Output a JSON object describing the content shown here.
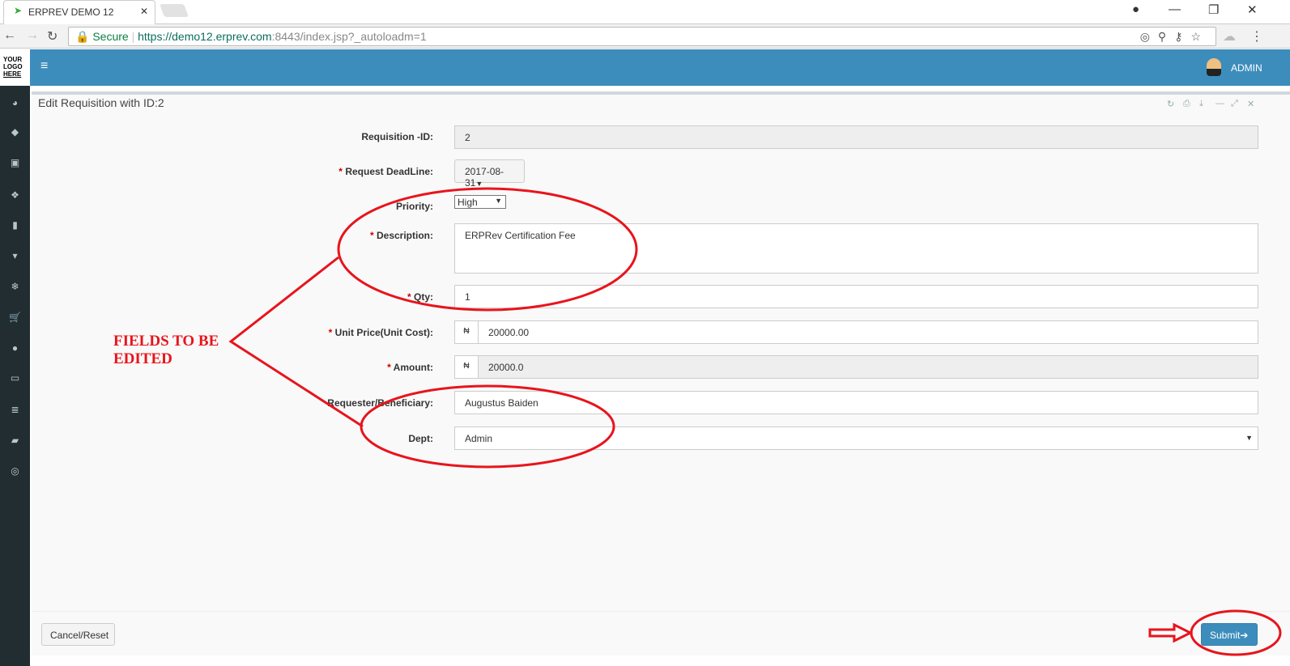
{
  "browser": {
    "tab_title": "ERPREV DEMO 12",
    "secure_label": "Secure",
    "url_host": "https://demo12.erprev.com",
    "url_rest": ":8443/index.jsp?_autoloadm=1"
  },
  "header": {
    "logo": "YOUR LOGO HERE",
    "user": "ADMIN",
    "accent": "#3c8dbc"
  },
  "sidebar": {
    "icons": [
      "dashboard-icon",
      "tag-icon",
      "money-icon",
      "cubes-icon",
      "building-icon",
      "trash-icon",
      "snowflake-icon",
      "cart-icon",
      "circle-icon",
      "desktop-icon",
      "database-icon",
      "book-icon",
      "lifebuoy-icon"
    ]
  },
  "panel": {
    "title": "Edit Requisition with ID:2"
  },
  "form": {
    "id_label": "Requisition -ID:",
    "id_value": "2",
    "deadline_label": "Request DeadLine:",
    "deadline_value": "2017-08-31",
    "priority_label": "Priority:",
    "priority_value": "High",
    "description_label": "Description:",
    "description_value": "ERPRev Certification Fee",
    "qty_label": "Qty:",
    "qty_value": "1",
    "unit_price_label": "Unit Price(Unit Cost):",
    "currency": "₦",
    "unit_price_value": "20000.00",
    "amount_label": "Amount:",
    "amount_value": "20000.0",
    "requester_label": "Requester/Beneficiary:",
    "requester_value": "Augustus Baiden",
    "dept_label": "Dept:",
    "dept_value": "Admin",
    "required_mark": "*"
  },
  "buttons": {
    "cancel": "Cancel/Reset",
    "submit": "Submit"
  },
  "annotation": {
    "text": "FIELDS TO BE EDITED",
    "color": "#e8141c"
  }
}
